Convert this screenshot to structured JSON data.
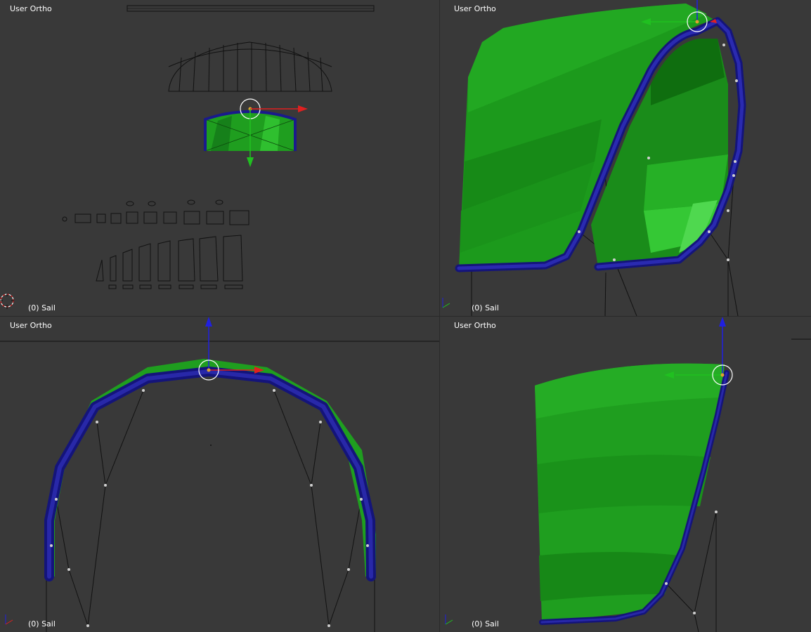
{
  "viewports": {
    "top_left": {
      "title": "User Ortho",
      "object_label": "(0) Sail"
    },
    "top_right": {
      "title": "User Ortho",
      "object_label": "(0) Sail"
    },
    "bottom_left": {
      "title": "User Ortho",
      "object_label": "(0) Sail"
    },
    "bottom_right": {
      "title": "User Ortho",
      "object_label": "(0) Sail"
    }
  },
  "colors": {
    "background": "#393939",
    "sail_green": "#1f9e1f",
    "tube_blue": "#1a1a8c",
    "axis_x": "#e02020",
    "axis_y": "#20c020",
    "axis_z": "#2020e0"
  },
  "icons": [
    "3d-cursor-icon",
    "transform-gizmo-icon",
    "axis-orientation-icon"
  ]
}
